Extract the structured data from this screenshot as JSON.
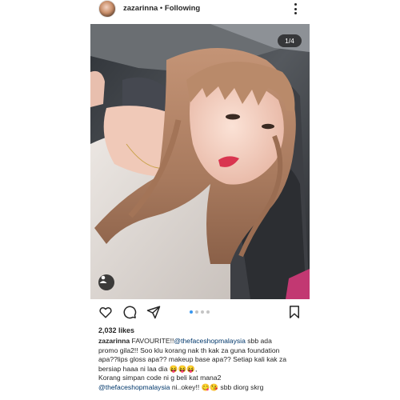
{
  "header": {
    "username": "zazarinna",
    "separator": " • ",
    "follow_status": "Following"
  },
  "photo": {
    "counter": "1/4",
    "accent_colors": {
      "hair": "#b98a6a",
      "skin": "#f1cdbf",
      "lips": "#d9354f",
      "sweater": "#e6e0dc",
      "car_seat": "#3d3f44"
    }
  },
  "carousel": {
    "total": 4,
    "active": 1
  },
  "likes": "2,032 likes",
  "caption": {
    "username": "zazarinna",
    "line1_before": " FAVOURITE!!",
    "mention1": "@thefaceshopmalaysia",
    "line1_after": "  sbb ada",
    "line2": "promo gila2!! Soo klu korang nak th kak za guna foundation",
    "line3": "apa??lips gloss apa?? makeup base apa?? Setiap kali kak za",
    "line4": "bersiap haaa ni laa dia 😝😝😝,",
    "line5": "Korang simpan code ni g beli kat mana2",
    "mention2": "@thefaceshopmalaysia",
    "line6_after": " ni..okey!! 😋😘 sbb diorg skrg"
  }
}
